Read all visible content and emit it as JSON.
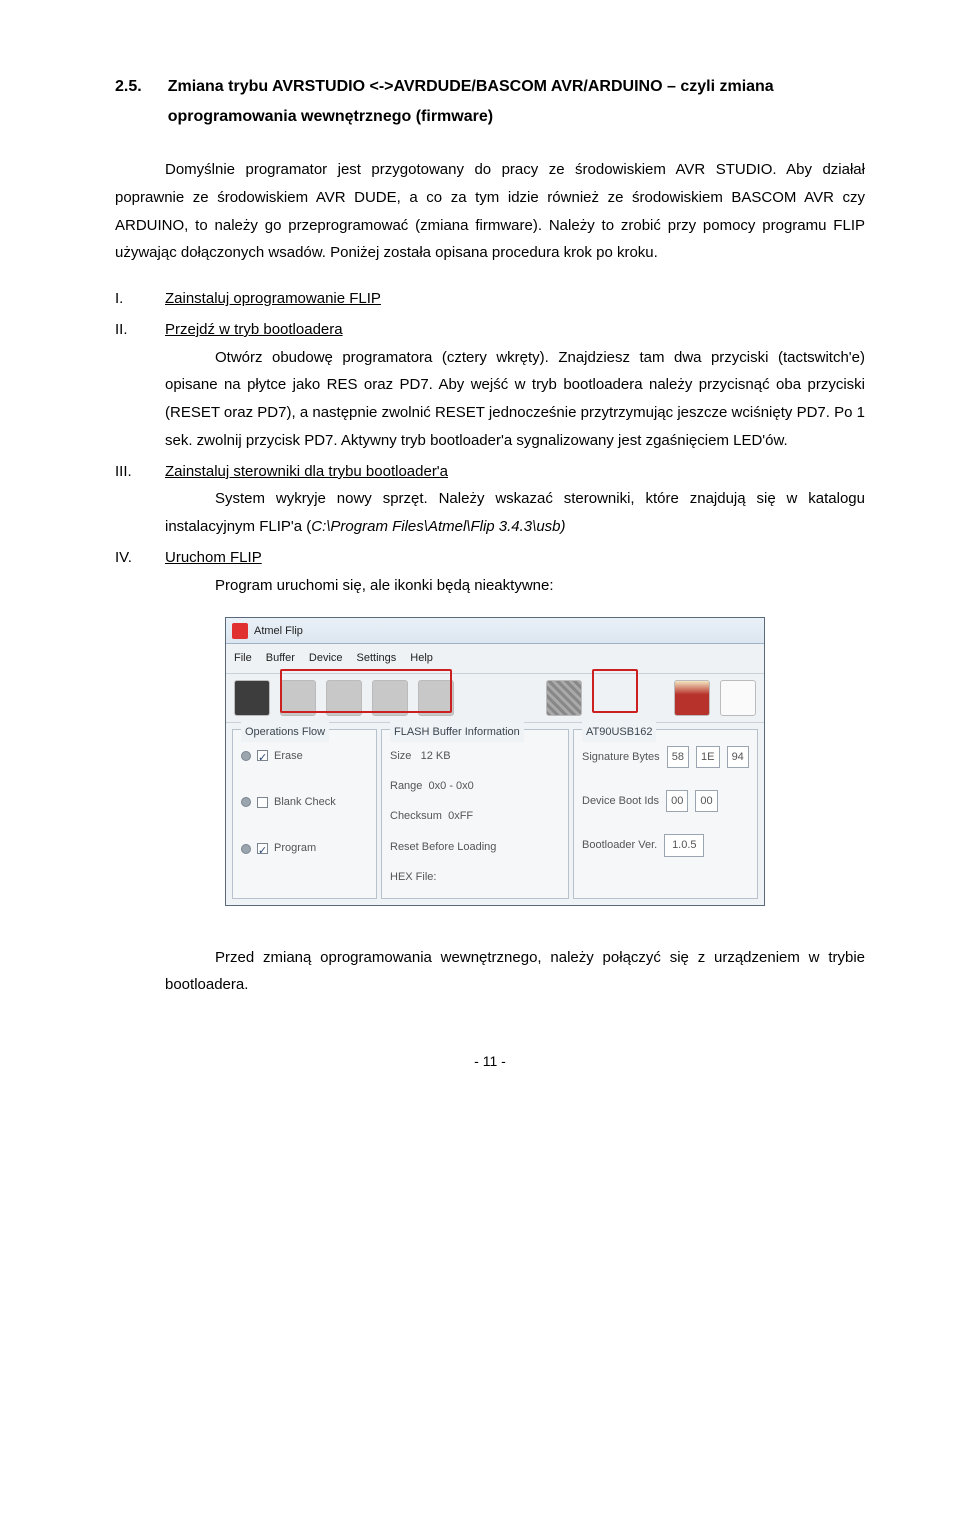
{
  "section": {
    "number": "2.5.",
    "title": "Zmiana trybu AVRSTUDIO <->AVRDUDE/BASCOM AVR/ARDUINO – czyli zmiana oprogramowania wewnętrznego (firmware)"
  },
  "intro_para": "Domyślnie programator jest przygotowany do pracy ze środowiskiem AVR STUDIO. Aby działał poprawnie ze środowiskiem AVR DUDE, a co za tym idzie również ze środowiskiem BASCOM AVR czy ARDUINO, to należy go przeprogramować (zmiana firmware). Należy to zrobić przy pomocy programu FLIP używając dołączonych wsadów. Poniżej została opisana procedura krok po kroku.",
  "items": [
    {
      "num": "I.",
      "label": "Zainstaluj oprogramowanie FLIP"
    },
    {
      "num": "II.",
      "label": "Przejdź w tryb bootloadera",
      "body": "Otwórz obudowę programatora (cztery wkręty). Znajdziesz tam dwa przyciski (tactswitch'e) opisane na płytce jako RES oraz PD7. Aby wejść w tryb bootloadera należy przycisnąć oba przyciski (RESET oraz PD7), a następnie zwolnić RESET jednocześnie przytrzymując jeszcze wciśnięty PD7. Po 1 sek. zwolnij przycisk PD7. Aktywny tryb bootloader'a sygnalizowany jest zgaśnięciem LED'ów."
    },
    {
      "num": "III.",
      "label": "Zainstaluj sterowniki dla trybu bootloader'a",
      "body_prefix": "System wykryje nowy sprzęt. Należy wskazać sterowniki, które znajdują się w katalogu instalacyjnym FLIP'a (",
      "body_italic": "C:\\Program Files\\Atmel\\Flip 3.4.3\\usb)",
      "body_suffix": ""
    },
    {
      "num": "IV.",
      "label": "Uruchom FLIP",
      "body": "Program uruchomi się, ale ikonki będą nieaktywne:"
    }
  ],
  "app": {
    "title": "Atmel Flip",
    "menu": [
      "File",
      "Buffer",
      "Device",
      "Settings",
      "Help"
    ],
    "left_panel_title": "Operations Flow",
    "left_ops": [
      {
        "label": "Erase",
        "checked": true
      },
      {
        "label": "Blank Check",
        "checked": false
      },
      {
        "label": "Program",
        "checked": true
      }
    ],
    "mid_panel_title": "FLASH Buffer Information",
    "mid_rows": {
      "size_label": "Size",
      "size_value": "12 KB",
      "range_label": "Range",
      "range_value": "0x0 - 0x0",
      "checksum_label": "Checksum",
      "checksum_value": "0xFF",
      "reset_label": "Reset Before Loading",
      "hex_label": "HEX File:"
    },
    "right_panel_title": "AT90USB162",
    "right_rows": {
      "sig_label": "Signature Bytes",
      "sig_values": [
        "58",
        "1E",
        "94"
      ],
      "devboot_label": "Device Boot Ids",
      "devboot_values": [
        "00",
        "00"
      ],
      "blver_label": "Bootloader Ver.",
      "blver_value": "1.0.5"
    }
  },
  "outro_para": "Przed zmianą oprogramowania wewnętrznego, należy połączyć się z urządzeniem w trybie bootloadera.",
  "page_number": "- 11 -"
}
